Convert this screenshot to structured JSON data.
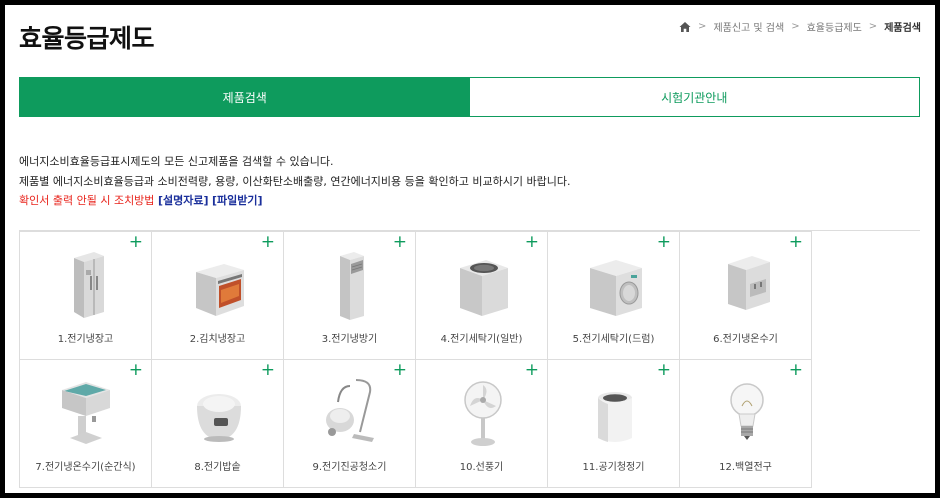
{
  "header": {
    "title": "효율등급제도"
  },
  "breadcrumb": {
    "items": [
      "제품신고 및 검색",
      "효율등급제도",
      "제품검색"
    ]
  },
  "tabs": [
    {
      "label": "제품검색",
      "active": true
    },
    {
      "label": "시험기관안내",
      "active": false
    }
  ],
  "description": {
    "line1": "에너지소비효율등급표시제도의 모든 신고제품을 검색할 수 있습니다.",
    "line2": "제품별 에너지소비효율등급과 소비전력량, 용량, 이산화탄소배출량, 연간에너지비용 등을 확인하고 비교하시기 바랍니다.",
    "notice": "확인서 출력 안될 시 조치방법",
    "link1": "[설명자료]",
    "link2": "[파일받기]"
  },
  "products": [
    {
      "label": "1.전기냉장고",
      "icon": "refrigerator-icon"
    },
    {
      "label": "2.김치냉장고",
      "icon": "kimchi-refrigerator-icon"
    },
    {
      "label": "3.전기냉방기",
      "icon": "air-conditioner-icon"
    },
    {
      "label": "4.전기세탁기(일반)",
      "icon": "top-load-washer-icon"
    },
    {
      "label": "5.전기세탁기(드럼)",
      "icon": "drum-washer-icon"
    },
    {
      "label": "6.전기냉온수기",
      "icon": "water-dispenser-icon"
    },
    {
      "label": "7.전기냉온수기(순간식)",
      "icon": "instant-water-dispenser-icon"
    },
    {
      "label": "8.전기밥솥",
      "icon": "rice-cooker-icon"
    },
    {
      "label": "9.전기진공청소기",
      "icon": "vacuum-cleaner-icon"
    },
    {
      "label": "10.선풍기",
      "icon": "electric-fan-icon"
    },
    {
      "label": "11.공기청정기",
      "icon": "air-purifier-icon"
    },
    {
      "label": "12.백열전구",
      "icon": "light-bulb-icon"
    }
  ],
  "colors": {
    "accent": "#0e9b5d",
    "notice": "#e8231b",
    "link": "#1a2f9b"
  }
}
